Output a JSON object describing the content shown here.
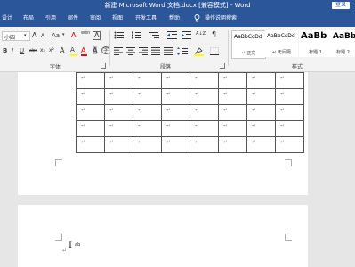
{
  "window": {
    "title": "新建 Microsoft Word 文档.docx [兼容模式] - Word",
    "login_label": "登录"
  },
  "tabs": [
    {
      "id": "design",
      "label": "设计"
    },
    {
      "id": "layout",
      "label": "布局"
    },
    {
      "id": "references",
      "label": "引用"
    },
    {
      "id": "mailings",
      "label": "邮件"
    },
    {
      "id": "review",
      "label": "审阅"
    },
    {
      "id": "view",
      "label": "视图"
    },
    {
      "id": "developer",
      "label": "开发工具"
    },
    {
      "id": "help",
      "label": "帮助"
    }
  ],
  "tell_me": {
    "icon": "lightbulb-icon",
    "label": "操作说明搜索"
  },
  "font": {
    "size_value": "小四",
    "grow_label": "A",
    "shrink_label": "A",
    "case_label": "Aa",
    "clear_format_label": "A",
    "phonetic_label": "wén",
    "border_char_label": "A",
    "bold_label": "B",
    "italic_label": "I",
    "underline_label": "U",
    "strike_label": "abc",
    "sub_label": "x₂",
    "sup_label": "x²",
    "highlight_label": "A",
    "color_label": "A",
    "shading_label": "A",
    "circle_label": "字",
    "group_label": "字体",
    "highlight_color": "#ffff00",
    "font_color": "#ff0000"
  },
  "paragraph": {
    "group_label": "段落",
    "sort_label": "A↓Z",
    "mark_label": "¶"
  },
  "styles": {
    "group_label": "样式",
    "items": [
      {
        "preview": "AaBbCcDd",
        "name": "↵ 正文",
        "selected": true
      },
      {
        "preview": "AaBbCcDd",
        "name": "↵ 无间隔",
        "selected": false
      },
      {
        "preview": "AaBb",
        "name": "标题 1",
        "selected": false
      },
      {
        "preview": "AaBb",
        "name": "标题 2",
        "selected": false
      }
    ]
  },
  "document": {
    "table": {
      "rows": [
        [
          "↵",
          "↵",
          "↵",
          "↵",
          "↵",
          "↵",
          "↵",
          "↵"
        ],
        [
          "↵",
          "↵",
          "↵",
          "↵",
          "↵",
          "↵",
          "↵",
          "↵"
        ],
        [
          "↵",
          "↵",
          "↵",
          "↵",
          "↵",
          "↵",
          "↵",
          "↵"
        ],
        [
          "↵",
          "↵",
          "↵",
          "↵",
          "↵",
          "↵",
          "↵",
          "↵"
        ],
        [
          "↵",
          "↵",
          "↵",
          "↵",
          "↵",
          "↵",
          "↵",
          "↵"
        ]
      ]
    },
    "cursor_paragraph_mark": "↵",
    "cursor_ime_label": "I",
    "cursor_ime_text": "ab"
  }
}
